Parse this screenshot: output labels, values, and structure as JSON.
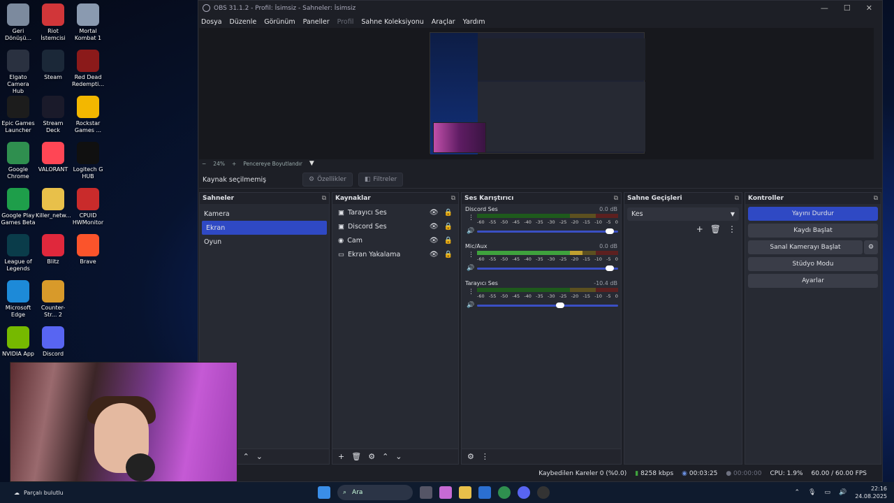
{
  "desktop": [
    {
      "label": "Geri Dönüşü...",
      "icon": "recycle-bin-icon",
      "color": "#7c8a9e",
      "col": 0,
      "row": 0
    },
    {
      "label": "Riot İstemcisi",
      "icon": "riot-icon",
      "color": "#d13639",
      "col": 1,
      "row": 0
    },
    {
      "label": "Mortal Kombat 1",
      "icon": "mortal-kombat-icon",
      "color": "#8a9ab0",
      "col": 2,
      "row": 0
    },
    {
      "label": "Elgato Camera Hub",
      "icon": "elgato-icon",
      "color": "#2a3140",
      "col": 0,
      "row": 1
    },
    {
      "label": "Steam",
      "icon": "steam-icon",
      "color": "#1b2838",
      "col": 1,
      "row": 1
    },
    {
      "label": "Red Dead Redempti...",
      "icon": "red-dead-icon",
      "color": "#8b1a1a",
      "col": 2,
      "row": 1
    },
    {
      "label": "Epic Games Launcher",
      "icon": "epic-games-icon",
      "color": "#1c1c1c",
      "col": 0,
      "row": 2
    },
    {
      "label": "Stream Deck",
      "icon": "stream-deck-icon",
      "color": "#1a1a2a",
      "col": 1,
      "row": 2
    },
    {
      "label": "Rockstar Games ...",
      "icon": "rockstar-icon",
      "color": "#f3b700",
      "col": 2,
      "row": 2
    },
    {
      "label": "Google Chrome",
      "icon": "chrome-icon",
      "color": "#2f8f4f",
      "col": 0,
      "row": 3
    },
    {
      "label": "VALORANT",
      "icon": "valorant-icon",
      "color": "#ff4655",
      "col": 1,
      "row": 3
    },
    {
      "label": "Logitech G HUB",
      "icon": "logitech-icon",
      "color": "#101010",
      "col": 2,
      "row": 3
    },
    {
      "label": "Google Play Games Beta",
      "icon": "play-games-icon",
      "color": "#1e9e4a",
      "col": 0,
      "row": 4
    },
    {
      "label": "Killer_netw...",
      "icon": "folder-icon",
      "color": "#e8c04a",
      "col": 1,
      "row": 4
    },
    {
      "label": "CPUID HWMonitor",
      "icon": "hwmonitor-icon",
      "color": "#c92b2b",
      "col": 2,
      "row": 4
    },
    {
      "label": "League of Legends",
      "icon": "league-icon",
      "color": "#0a3c4a",
      "col": 0,
      "row": 5
    },
    {
      "label": "Blitz",
      "icon": "blitz-icon",
      "color": "#e0283c",
      "col": 1,
      "row": 5
    },
    {
      "label": "Brave",
      "icon": "brave-icon",
      "color": "#fb542b",
      "col": 2,
      "row": 5
    },
    {
      "label": "Microsoft Edge",
      "icon": "edge-icon",
      "color": "#1d8ad8",
      "col": 0,
      "row": 6
    },
    {
      "label": "Counter-Str... 2",
      "icon": "cs2-icon",
      "color": "#d89a2a",
      "col": 1,
      "row": 6
    },
    {
      "label": "NVIDIA App",
      "icon": "nvidia-icon",
      "color": "#76b900",
      "col": 0,
      "row": 7
    },
    {
      "label": "Discord",
      "icon": "discord-icon",
      "color": "#5865f2",
      "col": 1,
      "row": 7
    }
  ],
  "window": {
    "title": "OBS 31.1.2 - Profil: İsimsiz - Sahneler: İsimsiz",
    "minimize": "—",
    "maximize": "☐",
    "close": "✕"
  },
  "menu": [
    "Dosya",
    "Düzenle",
    "Görünüm",
    "Paneller",
    "Profil",
    "Sahne Koleksiyonu",
    "Araçlar",
    "Yardım"
  ],
  "zoom": {
    "minus": "−",
    "value": "24%",
    "plus": "+",
    "fit": "Pencereye Boyutlandır",
    "dropdown": "▼"
  },
  "source_bar": {
    "text": "Kaynak seçilmemiş",
    "props": "Özellikler",
    "filters": "Filtreler"
  },
  "scenes": {
    "title": "Sahneler",
    "items": [
      "Kamera",
      "Ekran",
      "Oyun"
    ],
    "selected": 1
  },
  "sources": {
    "title": "Kaynaklar",
    "items": [
      {
        "name": "Tarayıcı Ses",
        "icon": "browser-source-icon"
      },
      {
        "name": "Discord Ses",
        "icon": "browser-source-icon"
      },
      {
        "name": "Cam",
        "icon": "camera-icon"
      },
      {
        "name": "Ekran Yakalama",
        "icon": "display-capture-icon"
      }
    ]
  },
  "mixer": {
    "title": "Ses Karıştırıcı",
    "scale": [
      "-60",
      "-55",
      "-50",
      "-45",
      "-40",
      "-35",
      "-30",
      "-25",
      "-20",
      "-15",
      "-10",
      "-5",
      "0"
    ],
    "channels": [
      {
        "name": "Discord Ses",
        "db": "0.0 dB",
        "level": 0,
        "volume": 0.97
      },
      {
        "name": "Mic/Aux",
        "db": "0.0 dB",
        "level": 0.75,
        "volume": 0.97
      },
      {
        "name": "Tarayıcı Ses",
        "db": "-10.4 dB",
        "level": 0,
        "volume": 0.62
      }
    ]
  },
  "transitions": {
    "title": "Sahne Geçişleri",
    "selected": "Kes"
  },
  "controls": {
    "title": "Kontroller",
    "buttons": [
      "Yayını Durdur",
      "Kaydı Başlat",
      "Sanal Kamerayı Başlat",
      "Stüdyo Modu",
      "Ayarlar"
    ]
  },
  "status": {
    "dropped": "Kaybedilen Kareler 0 (%0.0)",
    "bitrate": "8258 kbps",
    "stream_time": "00:03:25",
    "rec_time": "00:00:00",
    "cpu": "CPU: 1.9%",
    "fps": "60.00 / 60.00 FPS"
  },
  "taskbar": {
    "weather": "Parçalı bulutlu",
    "search": "Ara",
    "time": "22:16",
    "date": "24.08.2025"
  }
}
